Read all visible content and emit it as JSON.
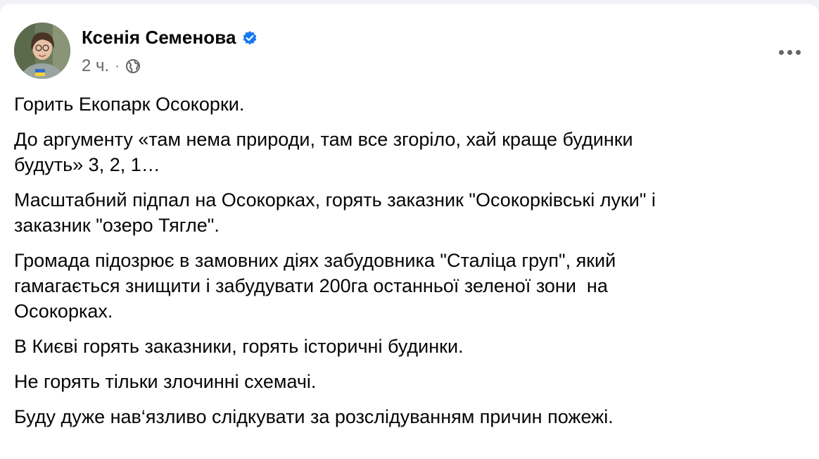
{
  "post": {
    "author": {
      "name": "Ксенія Семенова",
      "verified": true
    },
    "time": "2 ч.",
    "separator": "·",
    "visibility_icon": "globe-icon",
    "more_icon": "more-options-icon",
    "paragraphs": [
      "Горить Екопарк Осокорки.",
      "До аргументу «там нема природи, там все згоріло, хай краще будинки\nбудуть» 3, 2, 1…",
      "Масштабний підпал на Осокорках, горять заказник \"Осокорківські луки\" і\nзаказник \"озеро Тягле\".",
      "Громада підозрює в замовних діях забудовника \"Сталіца груп\", який\nгамагається знищити і забудувати 200га останньої зеленої зони  на\nОсокорках.",
      "В Києві горять заказники, горять історичні будинки.",
      "Не горять тільки злочинні схемачі.",
      "Буду дуже нав‘язливо слідкувати за розслідуванням причин пожежі."
    ]
  },
  "colors": {
    "background": "#f0f2f5",
    "card": "#ffffff",
    "text": "#050505",
    "secondary_text": "#65676b",
    "verified_blue": "#1877f2"
  }
}
